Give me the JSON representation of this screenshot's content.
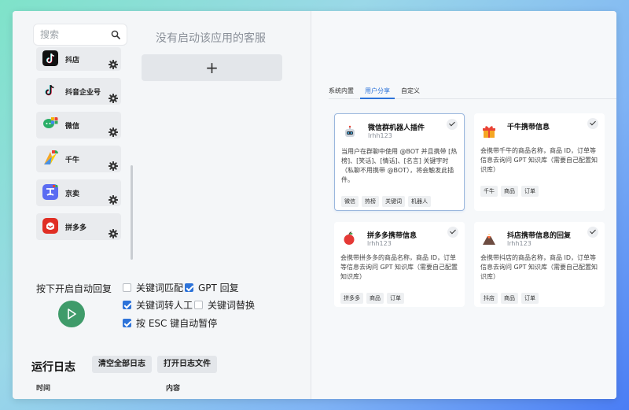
{
  "search": {
    "placeholder": "搜索"
  },
  "apps": [
    {
      "label": "抖店",
      "icon": "douyin-icon"
    },
    {
      "label": "抖音企业号",
      "icon": "douyin-icon"
    },
    {
      "label": "微信",
      "icon": "wechat-icon"
    },
    {
      "label": "千牛",
      "icon": "qianniu-icon"
    },
    {
      "label": "京卖",
      "icon": "jingmai-icon"
    },
    {
      "label": "拼多多",
      "icon": "pinduoduo-icon"
    }
  ],
  "main": {
    "no_service_text": "没有启动该应用的客服",
    "add_label": "+"
  },
  "auto_reply": {
    "label": "按下开启自动回复",
    "options": [
      {
        "label": "关键词匹配",
        "checked": false
      },
      {
        "label": "GPT 回复",
        "checked": true
      },
      {
        "label": "关键词转人工",
        "checked": true
      },
      {
        "label": "关键词替换",
        "checked": false
      },
      {
        "label": "按 ESC 键自动暂停",
        "checked": true
      }
    ]
  },
  "log": {
    "title": "运行日志",
    "clear_label": "清空全部日志",
    "open_label": "打开日志文件",
    "col_time": "时间",
    "col_content": "内容"
  },
  "tabs": [
    {
      "label": "系统内置",
      "active": false
    },
    {
      "label": "用户分享",
      "active": true
    },
    {
      "label": "自定义",
      "active": false
    }
  ],
  "cards": [
    {
      "title": "微信群机器人插件",
      "author": "lrhh123",
      "desc": "当用户在群聊中使用 @BOT 并且携带 [热榜]、[笑话]、[情话]、[名言] 关键字时（私聊不用携带 @BOT），将会触发此插件。",
      "tags": [
        "微信",
        "热榜",
        "关键词",
        "机器人"
      ],
      "icon": "robot-icon"
    },
    {
      "title": "千牛携带信息",
      "author": "lrhh123",
      "desc": "会携带千牛的商品名称，商品 ID，订单等信息去询问 GPT 知识库（需要自己配置知识库）",
      "tags": [
        "千牛",
        "商品",
        "订单"
      ],
      "icon": "gift-icon"
    },
    {
      "title": "拼多多携带信息",
      "author": "lrhh123",
      "desc": "会携带拼多多的商品名称，商品 ID，订单等信息去询问 GPT 知识库（需要自己配置知识库）",
      "tags": [
        "拼多多",
        "商品",
        "订单"
      ],
      "icon": "apple-icon"
    },
    {
      "title": "抖店携带信息的回复",
      "author": "lrhh123",
      "desc": "会携带抖店的商品名称，商品 ID，订单等信息去询问 GPT 知识库（需要自己配置知识库）",
      "tags": [
        "抖店",
        "商品",
        "订单"
      ],
      "icon": "volcano-icon"
    }
  ],
  "colors": {
    "accent": "#2d73d9",
    "play": "#3f9b6a"
  }
}
